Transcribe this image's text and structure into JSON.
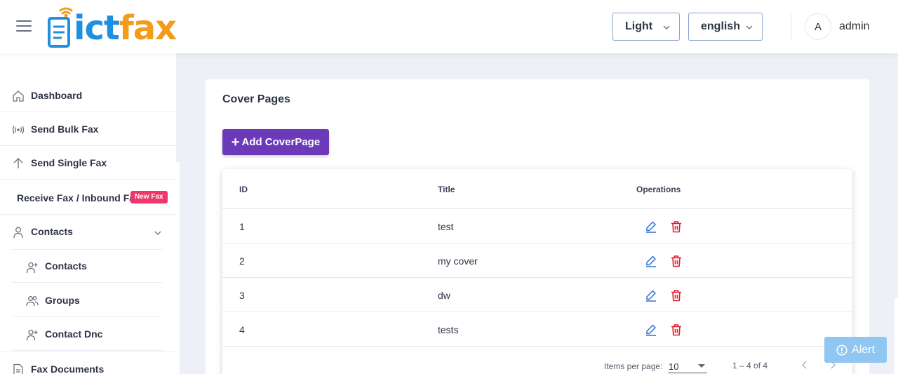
{
  "header": {
    "logo_text_ict": "ict",
    "logo_text_fax": "fax",
    "theme_value": "Light",
    "language_value": "english",
    "avatar_initial": "A",
    "username": "admin"
  },
  "sidebar": {
    "items": [
      {
        "label": "Dashboard",
        "icon": "home-icon"
      },
      {
        "label": "Send Bulk Fax",
        "icon": "broadcast-icon"
      },
      {
        "label": "Send Single Fax",
        "icon": "arrow-up-icon"
      },
      {
        "label": "Receive Fax / Inbound Fax",
        "badge": "New Fax"
      },
      {
        "label": "Contacts",
        "icon": "user-icon",
        "expanded": true
      },
      {
        "label": "Contacts",
        "icon": "user-plus-icon",
        "sub": true
      },
      {
        "label": "Groups",
        "icon": "users-icon",
        "sub": true
      },
      {
        "label": "Contact Dnc",
        "icon": "user-plus-icon",
        "sub": true
      },
      {
        "label": "Fax Documents",
        "icon": "document-icon"
      }
    ]
  },
  "main": {
    "title": "Cover Pages",
    "add_button": "Add CoverPage",
    "table": {
      "columns": [
        "ID",
        "Title",
        "Operations"
      ],
      "rows": [
        {
          "id": "1",
          "title": "test"
        },
        {
          "id": "2",
          "title": "my cover"
        },
        {
          "id": "3",
          "title": "dw"
        },
        {
          "id": "4",
          "title": "tests"
        }
      ]
    },
    "paginator": {
      "items_per_page_label": "Items per page:",
      "items_per_page_value": "10",
      "range_label": "1 – 4 of 4"
    }
  },
  "alert_button": "Alert",
  "colors": {
    "accent_purple": "#6a3ab8",
    "badge_pink": "#f0366b",
    "edit_blue": "#2f6fd6",
    "delete_red": "#e0192b",
    "logo_blue": "#1f8fe0",
    "logo_orange": "#f39c1b"
  }
}
